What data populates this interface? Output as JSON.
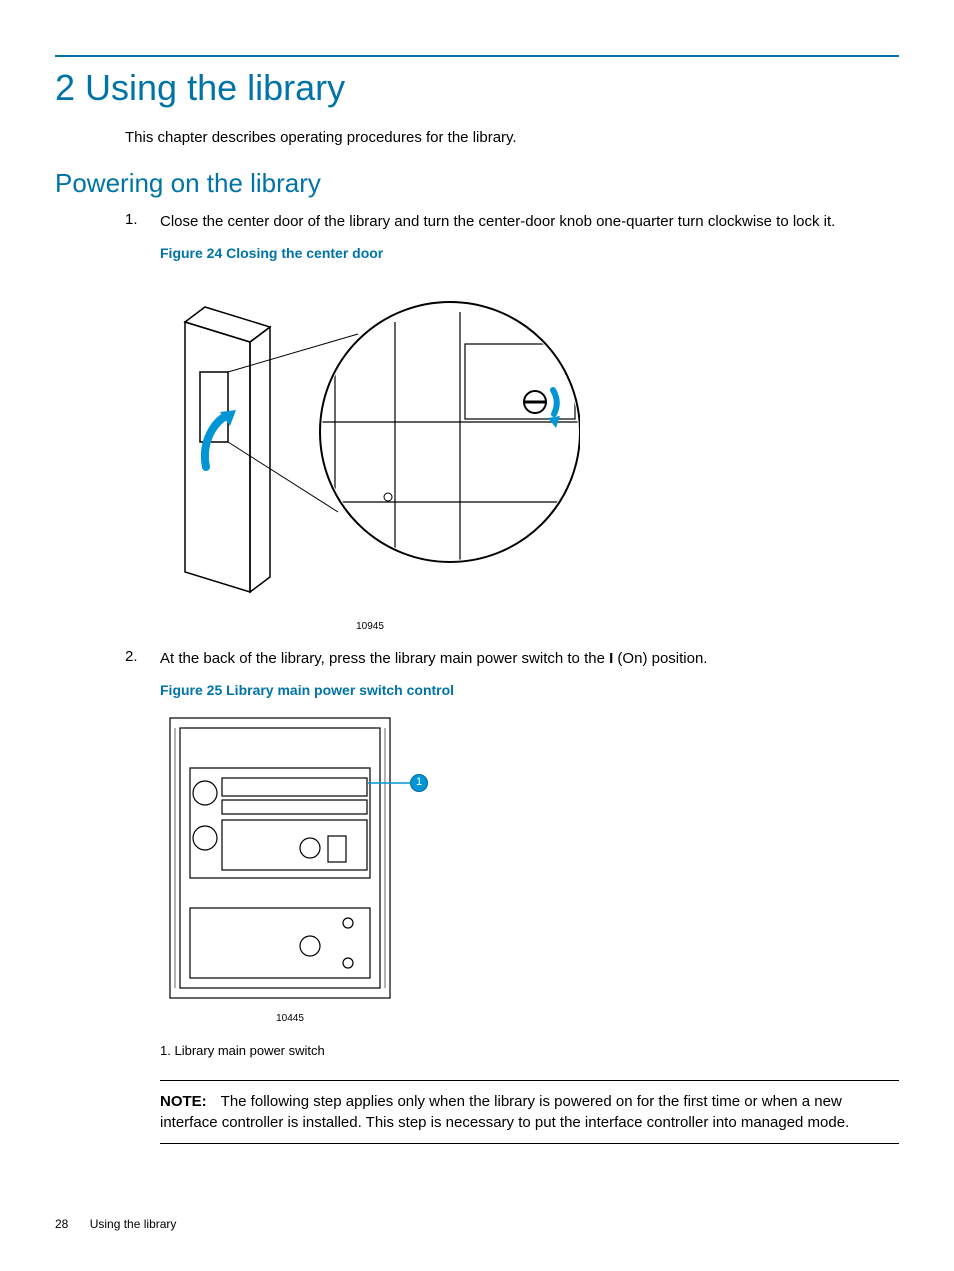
{
  "chapter": {
    "number": "2",
    "title": "2 Using the library",
    "intro": "This chapter describes operating procedures for the library."
  },
  "section": {
    "title": "Powering on the library"
  },
  "steps": [
    {
      "num": "1.",
      "text": "Close the center door of the library and turn the center-door knob one-quarter turn clockwise to lock it.",
      "figure": {
        "caption": "Figure 24 Closing the center door",
        "img_number": "10945"
      }
    },
    {
      "num": "2.",
      "text_prefix": "At the back of the library, press the library main power switch to the ",
      "text_bold": "I",
      "text_suffix": " (On) position.",
      "figure": {
        "caption": "Figure 25 Library main power switch control",
        "img_number": "10445",
        "callout_badge": "1",
        "callouts": [
          {
            "num": "1.",
            "label": "Library main power switch"
          }
        ]
      }
    }
  ],
  "note": {
    "label": "NOTE:",
    "text": "The following step applies only when the library is powered on for the first time or when a new interface controller is installed. This step is necessary to put the interface controller into managed mode."
  },
  "footer": {
    "page": "28",
    "title": "Using the library"
  }
}
